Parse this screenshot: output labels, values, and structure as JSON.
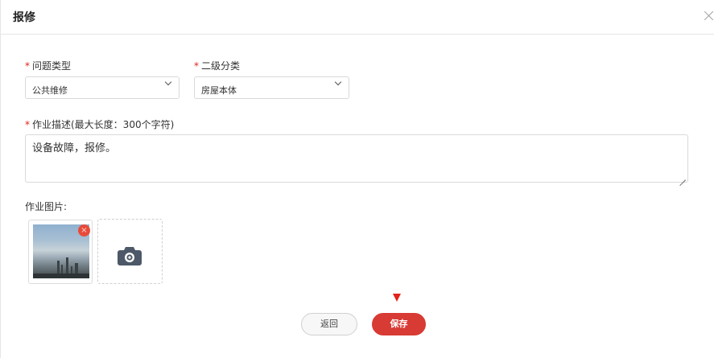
{
  "dialog": {
    "title": "报修"
  },
  "form": {
    "issue_type": {
      "label": "问题类型",
      "value": "公共维修"
    },
    "sub_category": {
      "label": "二级分类",
      "value": "房屋本体"
    },
    "description": {
      "label": "作业描述(最大长度：300个字符)",
      "value": "设备故障，报修。"
    },
    "images": {
      "label": "作业图片:",
      "remove_glyph": "×"
    },
    "required_mark": "*"
  },
  "actions": {
    "back_label": "返回",
    "save_label": "保存"
  },
  "icons": {
    "close": "close-icon",
    "chevron": "chevron-down-icon",
    "camera": "camera-icon",
    "arrow": "arrow-down-indicator"
  },
  "colors": {
    "accent": "#d83a34",
    "required": "#e2231a",
    "remove": "#e84b3a"
  }
}
